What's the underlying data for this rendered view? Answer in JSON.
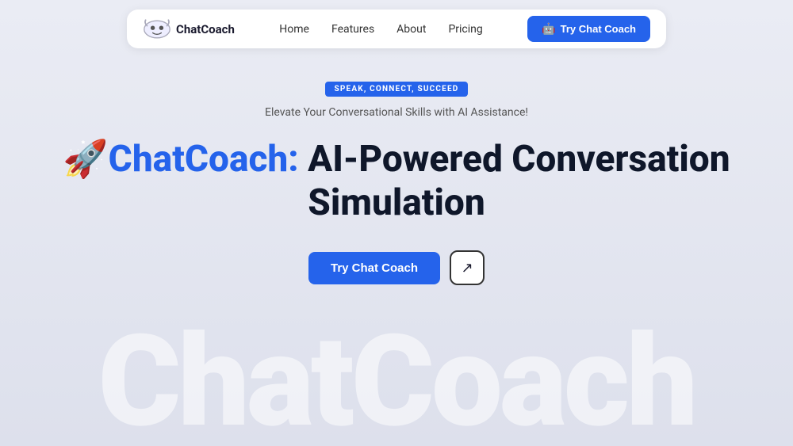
{
  "navbar": {
    "logo_text": "ChatCoach",
    "links": [
      {
        "label": "Home",
        "id": "home"
      },
      {
        "label": "Features",
        "id": "features"
      },
      {
        "label": "About",
        "id": "about"
      },
      {
        "label": "Pricing",
        "id": "pricing"
      }
    ],
    "cta_label": "Try Chat Coach"
  },
  "hero": {
    "badge": "SPEAK, CONNECT, SUCCEED",
    "subtitle": "Elevate Your Conversational Skills with AI Assistance!",
    "title_emoji": "🚀",
    "title_brand": "ChatCoach:",
    "title_rest": " AI-Powered Conversation Simulation",
    "cta_label": "Try Chat Coach",
    "external_icon": "↗"
  },
  "bg_text": "ChatCoach"
}
